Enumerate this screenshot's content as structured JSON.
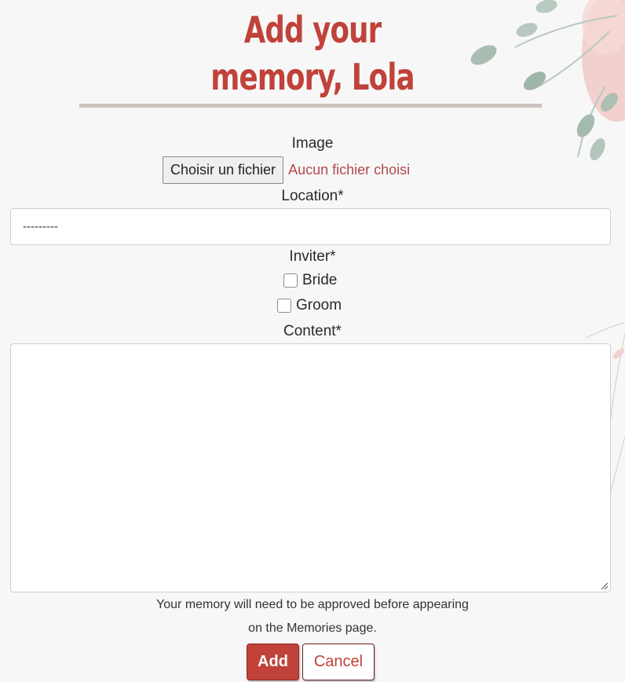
{
  "page": {
    "title_line1": "Add your",
    "title_line2": "memory, Lola"
  },
  "form": {
    "image": {
      "label": "Image",
      "button_label": "Choisir un fichier",
      "status": "Aucun fichier choisi"
    },
    "location": {
      "label": "Location*",
      "selected_value": "---------"
    },
    "inviter": {
      "label": "Inviter*",
      "options": [
        {
          "label": "Bride",
          "checked": false
        },
        {
          "label": "Groom",
          "checked": false
        }
      ]
    },
    "content": {
      "label": "Content*",
      "value": ""
    },
    "note_line1": "Your memory will need to be approved before appearing",
    "note_line2": "on the Memories page."
  },
  "actions": {
    "add_label": "Add",
    "cancel_label": "Cancel"
  },
  "colors": {
    "accent": "#c0423a",
    "title_underline": "#cdc4c2",
    "background": "#f7f7f7"
  },
  "icons": {
    "decoration": "floral-decoration-icon",
    "resize": "resize-grip-icon"
  }
}
